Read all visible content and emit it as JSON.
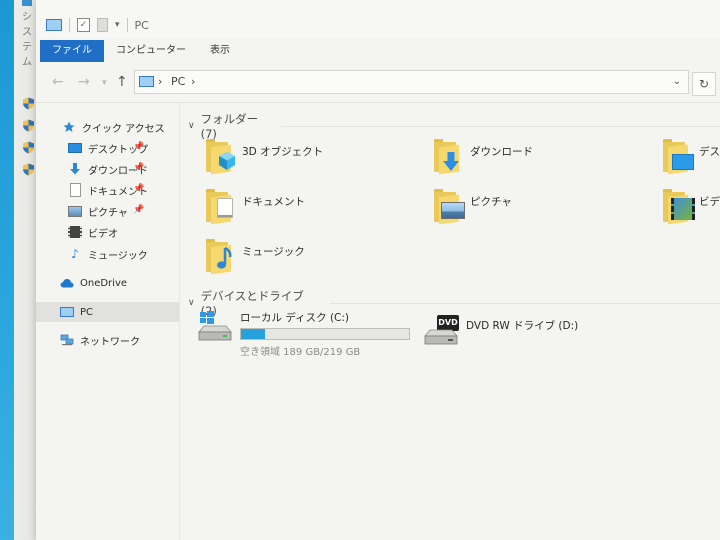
{
  "background_window": {
    "title": "システム"
  },
  "quick_access_toolbar": {
    "title": "PC"
  },
  "ribbon": {
    "tabs": [
      "ファイル",
      "コンピューター",
      "表示"
    ]
  },
  "address_bar": {
    "path": [
      "PC"
    ]
  },
  "sidebar": {
    "items": [
      {
        "label": "クイック アクセス",
        "icon": "star-icon",
        "pinned": false
      },
      {
        "label": "デスクトップ",
        "icon": "desktop-icon",
        "pinned": true
      },
      {
        "label": "ダウンロード",
        "icon": "download-icon",
        "pinned": true
      },
      {
        "label": "ドキュメント",
        "icon": "document-icon",
        "pinned": true
      },
      {
        "label": "ピクチャ",
        "icon": "pictures-icon",
        "pinned": true
      },
      {
        "label": "ビデオ",
        "icon": "video-icon",
        "pinned": false
      },
      {
        "label": "ミュージック",
        "icon": "music-icon",
        "pinned": false
      },
      {
        "label": "OneDrive",
        "icon": "cloud-icon",
        "pinned": false
      },
      {
        "label": "PC",
        "icon": "pc-icon",
        "pinned": false,
        "selected": true
      },
      {
        "label": "ネットワーク",
        "icon": "network-icon",
        "pinned": false
      }
    ]
  },
  "folders_group": {
    "title": "フォルダー (7)",
    "items": [
      {
        "label": "3D オブジェクト",
        "icon": "3d-objects-icon"
      },
      {
        "label": "ダウンロード",
        "icon": "download-folder-icon"
      },
      {
        "label": "デス",
        "icon": "desktop-folder-icon"
      },
      {
        "label": "ドキュメント",
        "icon": "document-folder-icon"
      },
      {
        "label": "ピクチャ",
        "icon": "pictures-folder-icon"
      },
      {
        "label": "ビデ",
        "icon": "video-folder-icon"
      },
      {
        "label": "ミュージック",
        "icon": "music-folder-icon"
      }
    ]
  },
  "drives_group": {
    "title": "デバイスとドライブ (2)",
    "items": [
      {
        "label": "ローカル ディスク (C:)",
        "free_text": "空き領域 189 GB/219 GB",
        "used_fraction": 0.14,
        "icon": "local-disk-icon"
      },
      {
        "label": "DVD RW ドライブ (D:)",
        "icon": "dvd-drive-icon",
        "badge": "DVD"
      }
    ]
  },
  "colors": {
    "accent": "#1e6fc5",
    "progress": "#27a1db",
    "folder": "#f5d96e"
  }
}
